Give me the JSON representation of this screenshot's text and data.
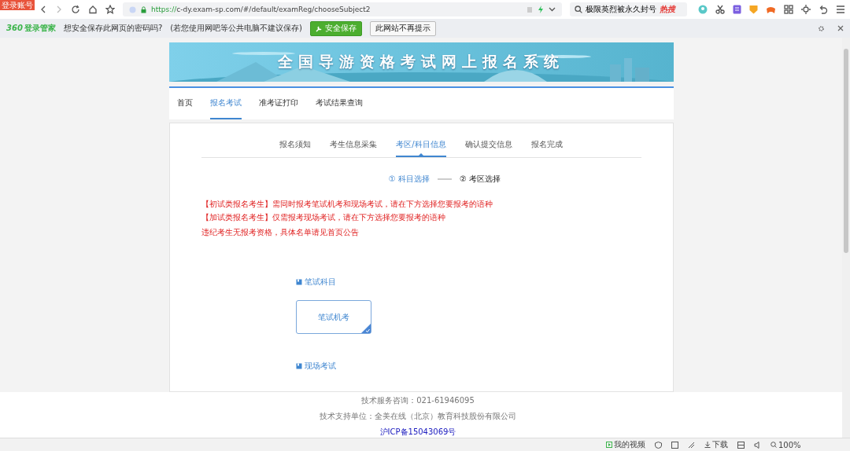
{
  "browser": {
    "account_badge": "登录账号",
    "url": {
      "scheme": "https://",
      "host": "c-dy.exam-sp.com",
      "path": "/#/default/examReg/chooseSubject2"
    },
    "search": {
      "value": "极限英烈被永久封号",
      "hot_label": "热搜"
    }
  },
  "password_bar": {
    "logo_number": "360",
    "logo_text": "登录管家",
    "prompt": "想安全保存此网页的密码吗?",
    "note": "(若您使用网吧等公共电脑不建议保存)",
    "buttons": [
      {
        "label": "安全保存",
        "kind": "primary"
      },
      {
        "label": "此网站不再提示",
        "kind": "plain"
      }
    ]
  },
  "banner": {
    "title": "全国导游资格考试网上报名系统"
  },
  "nav": [
    {
      "label": "首页",
      "selected": false
    },
    {
      "label": "报名考试",
      "selected": true
    },
    {
      "label": "准考证打印",
      "selected": false
    },
    {
      "label": "考试结果查询",
      "selected": false
    }
  ],
  "steps": [
    {
      "label": "报名须知",
      "selected": false
    },
    {
      "label": "考生信息采集",
      "selected": false
    },
    {
      "label": "考区/科目信息",
      "selected": true
    },
    {
      "label": "确认提交信息",
      "selected": false
    },
    {
      "label": "报名完成",
      "selected": false
    }
  ],
  "sub_steps": [
    {
      "label": "① 科目选择",
      "selected": true
    },
    {
      "label": "② 考区选择",
      "selected": false
    }
  ],
  "notices": [
    {
      "text": "【初试类报名考生】需同时报考笔试机考和现场考试，请在下方选择您要报考的语种",
      "kind": "strong"
    },
    {
      "text": "【加试类报名考生】仅需报考现场考试，请在下方选择您要报考的语种",
      "kind": "strong"
    },
    {
      "text": "违纪考生无报考资格，具体名单请见首页公告",
      "kind": "small"
    }
  ],
  "sections": [
    {
      "title": "笔试科目",
      "options": [
        {
          "label": "笔试机考",
          "selected": true
        }
      ]
    },
    {
      "title": "现场考试"
    }
  ],
  "footer": {
    "hotline": "技术服务咨询：021-61946095",
    "support": "技术支持单位：全美在线（北京）教育科技股份有限公司",
    "icp": "沪ICP备15043069号"
  },
  "status_bar": {
    "video": "我的视频",
    "download": "下载",
    "zoom": "100%"
  }
}
